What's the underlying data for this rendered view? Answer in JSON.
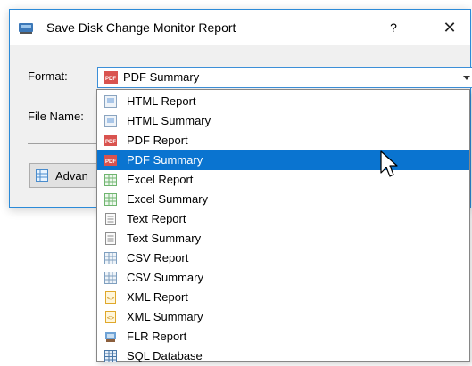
{
  "dialog": {
    "title": "Save Disk Change Monitor Report",
    "help_label": "?",
    "close_label": "✕",
    "format_label": "Format:",
    "filename_label": "File Name:",
    "advanced_label": "Advan",
    "selected_format": "PDF Summary"
  },
  "dropdown": {
    "items": [
      {
        "label": "HTML Report",
        "icon": "html-icon"
      },
      {
        "label": "HTML Summary",
        "icon": "html-icon"
      },
      {
        "label": "PDF Report",
        "icon": "pdf-icon"
      },
      {
        "label": "PDF Summary",
        "icon": "pdf-icon",
        "selected": true
      },
      {
        "label": "Excel Report",
        "icon": "excel-icon"
      },
      {
        "label": "Excel Summary",
        "icon": "excel-icon"
      },
      {
        "label": "Text Report",
        "icon": "text-icon"
      },
      {
        "label": "Text Summary",
        "icon": "text-icon"
      },
      {
        "label": "CSV Report",
        "icon": "csv-icon"
      },
      {
        "label": "CSV Summary",
        "icon": "csv-icon"
      },
      {
        "label": "XML Report",
        "icon": "xml-icon"
      },
      {
        "label": "XML Summary",
        "icon": "xml-icon"
      },
      {
        "label": "FLR Report",
        "icon": "flr-icon"
      },
      {
        "label": "SQL Database",
        "icon": "database-icon"
      }
    ]
  },
  "colors": {
    "accent": "#0a74d0",
    "pdf": "#d9534f",
    "excel": "#4caf50",
    "xml": "#f0b429"
  }
}
